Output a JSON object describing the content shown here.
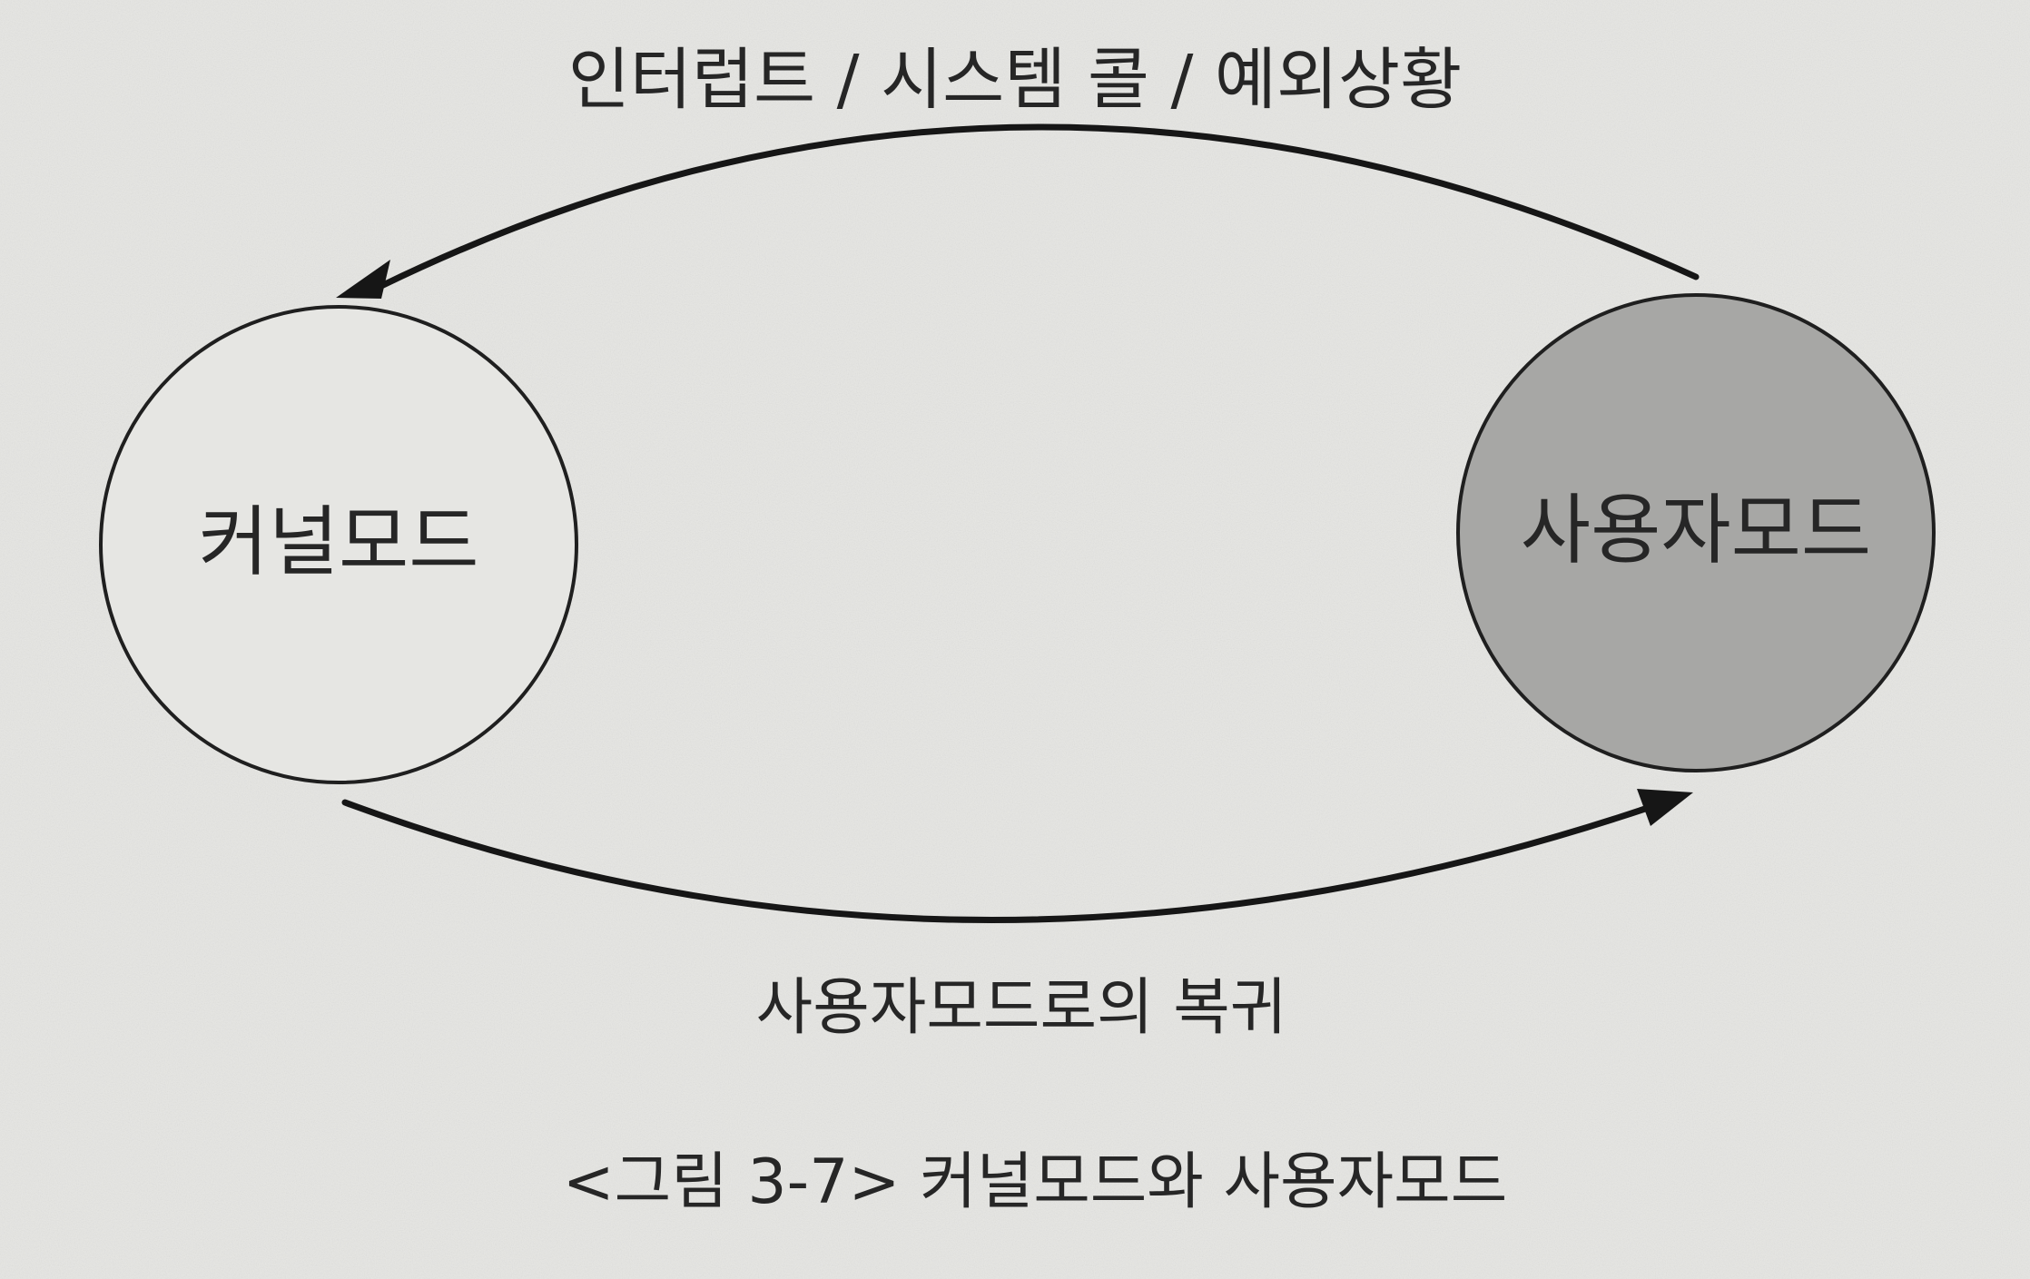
{
  "diagram": {
    "top_arrow_label": "인터럽트 / 시스템 콜 / 예외상황",
    "bottom_arrow_label": "사용자모드로의 복귀",
    "nodes": {
      "kernel_mode": {
        "label": "커널모드",
        "fill": "#e6e6e3"
      },
      "user_mode": {
        "label": "사용자모드",
        "fill": "#a7a7a5"
      }
    },
    "caption": "<그림 3-7> 커널모드와 사용자모드"
  }
}
